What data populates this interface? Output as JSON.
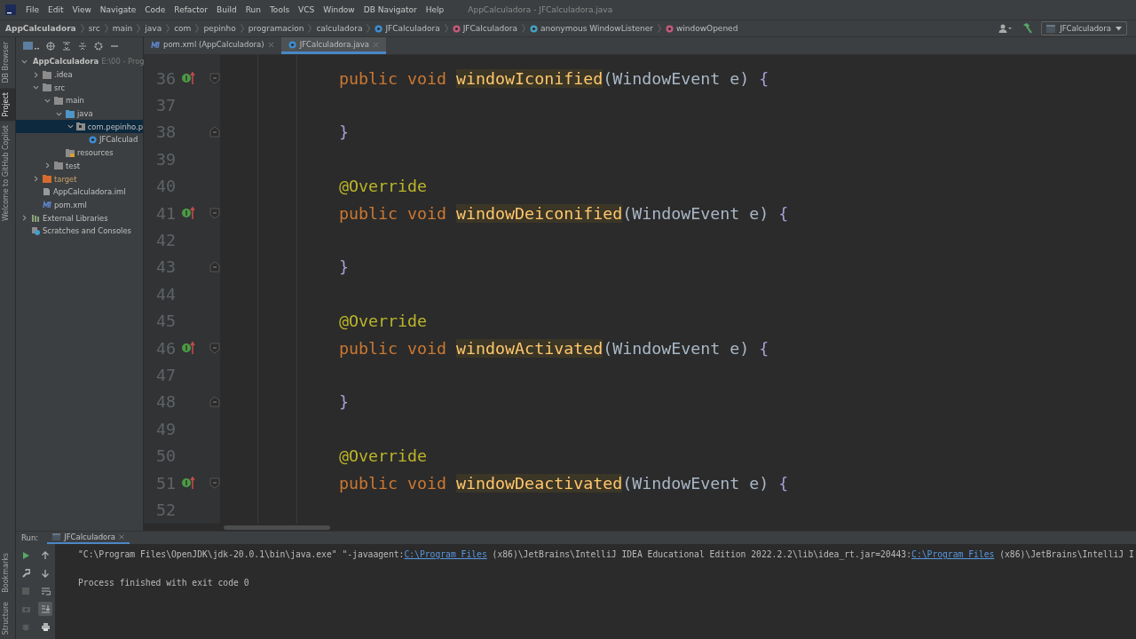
{
  "window": {
    "title": "AppCalculadora - JFCalculadora.java"
  },
  "menu": [
    "File",
    "Edit",
    "View",
    "Navigate",
    "Code",
    "Refactor",
    "Build",
    "Run",
    "Tools",
    "VCS",
    "Window",
    "DB Navigator",
    "Help"
  ],
  "breadcrumbs": [
    {
      "label": "AppCalculadora",
      "kind": "project"
    },
    {
      "label": "src",
      "kind": "folder"
    },
    {
      "label": "main",
      "kind": "folder"
    },
    {
      "label": "java",
      "kind": "folder"
    },
    {
      "label": "com",
      "kind": "folder"
    },
    {
      "label": "pepinho",
      "kind": "folder"
    },
    {
      "label": "programacion",
      "kind": "folder"
    },
    {
      "label": "calculadora",
      "kind": "folder"
    },
    {
      "label": "JFCalculadora",
      "kind": "class"
    },
    {
      "label": "JFCalculadora",
      "kind": "method"
    },
    {
      "label": "anonymous WindowListener",
      "kind": "anonymous"
    },
    {
      "label": "windowOpened",
      "kind": "method"
    }
  ],
  "run_config": {
    "label": "JFCalculadora"
  },
  "left_strip": {
    "top": [
      {
        "label": "DB Browser",
        "selected": false
      },
      {
        "label": "Project",
        "selected": true
      },
      {
        "label": "Welcome to GitHub Copilot",
        "selected": false
      }
    ],
    "bottom": [
      {
        "label": "Bookmarks",
        "selected": false
      },
      {
        "label": "Structure",
        "selected": false
      }
    ]
  },
  "project_tree": [
    {
      "label": "AppCalculadora",
      "path": "E:\\00 - Prog",
      "kind": "module",
      "expanded": true,
      "selected": false,
      "children": [
        {
          "label": ".idea",
          "kind": "folder",
          "expanded": false,
          "selected": false
        },
        {
          "label": "src",
          "kind": "folder",
          "expanded": true,
          "selected": false,
          "children": [
            {
              "label": "main",
              "kind": "folder",
              "expanded": true,
              "selected": false,
              "children": [
                {
                  "label": "java",
                  "kind": "source",
                  "expanded": true,
                  "selected": false,
                  "children": [
                    {
                      "label": "com.pepinho.p",
                      "kind": "package",
                      "expanded": true,
                      "selected": true,
                      "children": [
                        {
                          "label": "JFCalculad",
                          "kind": "class",
                          "selected": false
                        }
                      ]
                    }
                  ]
                },
                {
                  "label": "resources",
                  "kind": "resources",
                  "selected": false
                }
              ]
            },
            {
              "label": "test",
              "kind": "folder",
              "expanded": false,
              "selected": false
            }
          ]
        },
        {
          "label": "target",
          "kind": "excluded",
          "expanded": false,
          "selected": false
        },
        {
          "label": "AppCalculadora.iml",
          "kind": "file",
          "selected": false
        },
        {
          "label": "pom.xml",
          "kind": "maven",
          "selected": false
        }
      ]
    },
    {
      "label": "External Libraries",
      "kind": "library",
      "expanded": false,
      "selected": false
    },
    {
      "label": "Scratches and Consoles",
      "kind": "scratch",
      "selected": false
    }
  ],
  "editor_tabs": [
    {
      "label": "pom.xml (AppCalculadora)",
      "kind": "maven",
      "selected": false
    },
    {
      "label": "JFCalculadora.java",
      "kind": "class",
      "selected": true
    }
  ],
  "code_lines": [
    {
      "number": "36",
      "kind": "header",
      "tokens": [
        {
          "kind": "keyword",
          "text": "public void "
        },
        {
          "kind": "method",
          "text": "windowIconified"
        },
        {
          "kind": "plain",
          "text": "(WindowEvent e) "
        },
        {
          "kind": "brace",
          "text": "{"
        }
      ]
    },
    {
      "number": "37",
      "kind": "plain"
    },
    {
      "number": "38",
      "kind": "close",
      "tokens": [
        {
          "kind": "brace",
          "text": "}"
        }
      ]
    },
    {
      "number": "39",
      "kind": "plain"
    },
    {
      "number": "40",
      "kind": "plain",
      "tokens": [
        {
          "kind": "annotation",
          "text": "@Override"
        }
      ]
    },
    {
      "number": "41",
      "kind": "header",
      "tokens": [
        {
          "kind": "keyword",
          "text": "public void "
        },
        {
          "kind": "method",
          "text": "windowDeiconified"
        },
        {
          "kind": "plain",
          "text": "(WindowEvent e) "
        },
        {
          "kind": "brace",
          "text": "{"
        }
      ]
    },
    {
      "number": "42",
      "kind": "plain"
    },
    {
      "number": "43",
      "kind": "close",
      "tokens": [
        {
          "kind": "brace",
          "text": "}"
        }
      ]
    },
    {
      "number": "44",
      "kind": "plain"
    },
    {
      "number": "45",
      "kind": "plain",
      "tokens": [
        {
          "kind": "annotation",
          "text": "@Override"
        }
      ]
    },
    {
      "number": "46",
      "kind": "header",
      "tokens": [
        {
          "kind": "keyword",
          "text": "public void "
        },
        {
          "kind": "method",
          "text": "windowActivated"
        },
        {
          "kind": "plain",
          "text": "(WindowEvent e) "
        },
        {
          "kind": "brace",
          "text": "{"
        }
      ]
    },
    {
      "number": "47",
      "kind": "plain"
    },
    {
      "number": "48",
      "kind": "close",
      "tokens": [
        {
          "kind": "brace",
          "text": "}"
        }
      ]
    },
    {
      "number": "49",
      "kind": "plain"
    },
    {
      "number": "50",
      "kind": "plain",
      "tokens": [
        {
          "kind": "annotation",
          "text": "@Override"
        }
      ]
    },
    {
      "number": "51",
      "kind": "header",
      "tokens": [
        {
          "kind": "keyword",
          "text": "public void "
        },
        {
          "kind": "method",
          "text": "windowDeactivated"
        },
        {
          "kind": "plain",
          "text": "(WindowEvent e) "
        },
        {
          "kind": "brace",
          "text": "{"
        }
      ]
    },
    {
      "number": "52",
      "kind": "plain"
    }
  ],
  "run_panel": {
    "label": "Run:",
    "tab": "JFCalculadora",
    "tools_left": [
      {
        "kind": "rerun",
        "disabled": false,
        "selected": false
      },
      {
        "kind": "wrench",
        "disabled": false,
        "selected": false
      },
      {
        "kind": "stop",
        "disabled": true,
        "selected": false
      },
      {
        "kind": "camera",
        "disabled": true,
        "selected": false
      },
      {
        "kind": "bug",
        "disabled": true,
        "selected": false
      }
    ],
    "tools_right": [
      {
        "kind": "up",
        "disabled": false,
        "selected": false
      },
      {
        "kind": "down",
        "disabled": false,
        "selected": false
      },
      {
        "kind": "wrap",
        "disabled": false,
        "selected": false
      },
      {
        "kind": "scroll-end",
        "disabled": false,
        "selected": true
      },
      {
        "kind": "print",
        "disabled": false,
        "selected": false
      }
    ],
    "console": [
      [
        {
          "kind": "text",
          "text": "\"C:\\Program Files\\OpenJDK\\jdk-20.0.1\\bin\\java.exe\" \"-javaagent:"
        },
        {
          "kind": "link",
          "text": "C:\\Program Files"
        },
        {
          "kind": "text",
          "text": " (x86)\\JetBrains\\IntelliJ IDEA Educational Edition 2022.2.2\\lib\\idea_rt.jar=20443:"
        },
        {
          "kind": "link",
          "text": "C:\\Program Files"
        },
        {
          "kind": "text",
          "text": " (x86)\\JetBrains\\IntelliJ I"
        }
      ],
      [
        {
          "kind": "text",
          "text": "Process finished with exit code 0"
        }
      ]
    ]
  }
}
